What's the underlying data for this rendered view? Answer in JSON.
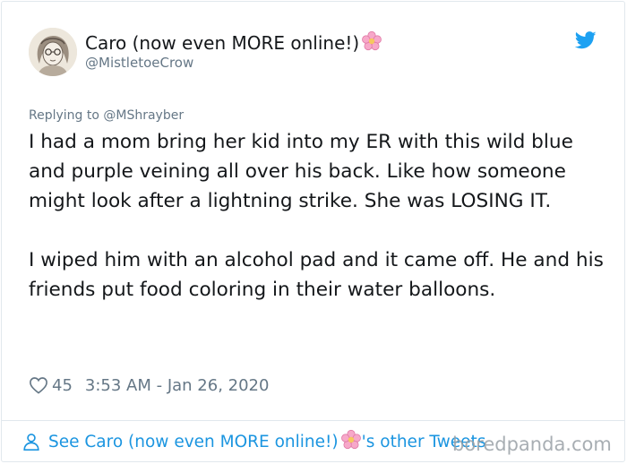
{
  "author": {
    "display_name": "Caro (now even MORE online!)",
    "name_emoji": "flower-emoji",
    "handle": "@MistletoeCrow",
    "avatar": "sketch-portrait-avatar"
  },
  "brand_icon": "twitter-bird-icon",
  "reply_context": "Replying to @MShrayber",
  "tweet": {
    "paragraphs": [
      "I had a mom bring her kid into my ER with this wild blue and purple veining all over his back. Like how someone might look after a lightning strike. She was LOSING IT.",
      "I wiped him with an alcohol pad and it came off. He and his friends put food coloring in their water balloons."
    ]
  },
  "meta": {
    "like_icon": "heart-outline-icon",
    "like_count": "45",
    "timestamp": "3:53 AM - Jan 26, 2020"
  },
  "footer": {
    "icon": "person-icon",
    "link_prefix": "See Caro (now even MORE online!)",
    "link_suffix": "'s other Tweets"
  },
  "watermark": "boredpanda.com",
  "colors": {
    "text": "#14171a",
    "secondary": "#657786",
    "link": "#1b95e0",
    "twitter_blue": "#1da1f2",
    "border": "#e1e8ed",
    "flower_pink": "#f7a8c9"
  }
}
